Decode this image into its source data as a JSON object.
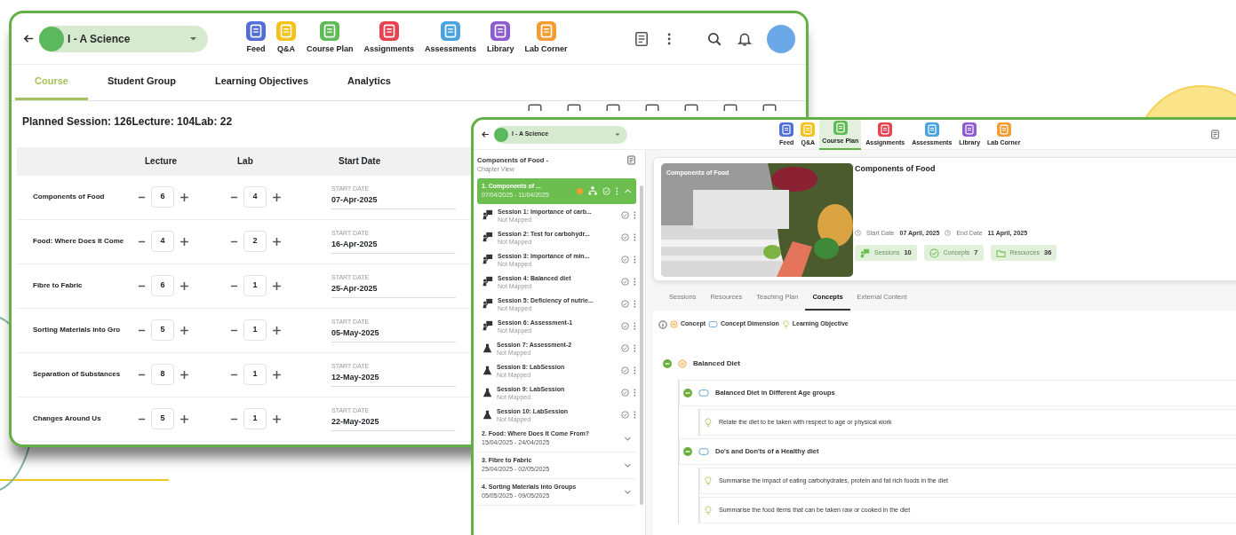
{
  "back_window": {
    "class_selector": {
      "label": "I - A Science"
    },
    "apps": [
      {
        "label": "Feed",
        "color": "#4f6fd6"
      },
      {
        "label": "Q&A",
        "color": "#f3c21b"
      },
      {
        "label": "Course Plan",
        "color": "#5fbb55"
      },
      {
        "label": "Assignments",
        "color": "#e6424f"
      },
      {
        "label": "Assessments",
        "color": "#4aa3df"
      },
      {
        "label": "Library",
        "color": "#8e5bd1"
      },
      {
        "label": "Lab Corner",
        "color": "#f39c33"
      }
    ],
    "tabs": [
      {
        "label": "Course",
        "selected": true
      },
      {
        "label": "Student Group",
        "selected": false
      },
      {
        "label": "Learning Objectives",
        "selected": false
      },
      {
        "label": "Analytics",
        "selected": false
      }
    ],
    "summary": "Planned Session: 126Lecture: 104Lab: 22",
    "table": {
      "columns": [
        "Lecture",
        "Lab",
        "Start Date"
      ],
      "rows": [
        {
          "chapter": "Components of Food",
          "lecture": "6",
          "lab": "4",
          "date_label": "START DATE",
          "start_date": "07-Apr-2025"
        },
        {
          "chapter": "Food: Where Does It Come",
          "lecture": "4",
          "lab": "2",
          "date_label": "START DATE",
          "start_date": "16-Apr-2025"
        },
        {
          "chapter": "Fibre to Fabric",
          "lecture": "6",
          "lab": "1",
          "date_label": "START DATE",
          "start_date": "25-Apr-2025"
        },
        {
          "chapter": "Sorting Materials into Gro",
          "lecture": "5",
          "lab": "1",
          "date_label": "START DATE",
          "start_date": "05-May-2025"
        },
        {
          "chapter": "Separation of Substances",
          "lecture": "8",
          "lab": "1",
          "date_label": "START DATE",
          "start_date": "12-May-2025"
        },
        {
          "chapter": "Changes Around Us",
          "lecture": "5",
          "lab": "1",
          "date_label": "START DATE",
          "start_date": "22-May-2025"
        }
      ]
    }
  },
  "front_window": {
    "class_selector": {
      "label": "I - A Science"
    },
    "apps": [
      {
        "label": "Feed",
        "color": "#4f6fd6",
        "selected": false
      },
      {
        "label": "Q&A",
        "color": "#f3c21b",
        "selected": false
      },
      {
        "label": "Course Plan",
        "color": "#5fbb55",
        "selected": true
      },
      {
        "label": "Assignments",
        "color": "#e6424f",
        "selected": false
      },
      {
        "label": "Assessments",
        "color": "#4aa3df",
        "selected": false
      },
      {
        "label": "Library",
        "color": "#8e5bd1",
        "selected": false
      },
      {
        "label": "Lab Corner",
        "color": "#f39c33",
        "selected": false
      }
    ],
    "sidebar": {
      "title": "Components of Food -",
      "subtitle": "Chapter View",
      "chapters": [
        {
          "title": "1. Components of ...",
          "dates": "07/04/2025 - 11/04/2025",
          "selected": true,
          "expanded": true,
          "sessions": [
            {
              "kind": "lecture",
              "title": "Session 1: Importance of carb...",
              "status": "Not Mapped"
            },
            {
              "kind": "lecture",
              "title": "Session 2: Test for carbohydr...",
              "status": "Not Mapped"
            },
            {
              "kind": "lecture",
              "title": "Session 3: Importance of min...",
              "status": "Not Mapped"
            },
            {
              "kind": "lecture",
              "title": "Session 4: Balanced diet",
              "status": "Not Mapped"
            },
            {
              "kind": "lecture",
              "title": "Session 5: Deficiency of nutrie...",
              "status": "Not Mapped"
            },
            {
              "kind": "lecture",
              "title": "Session 6: Assessment-1",
              "status": "Not Mapped"
            },
            {
              "kind": "lab",
              "title": "Session 7: Assessment-2",
              "status": "Not Mapped"
            },
            {
              "kind": "lab",
              "title": "Session 8: LabSession",
              "status": "Not Mapped"
            },
            {
              "kind": "lab",
              "title": "Session 9: LabSession",
              "status": "Not Mapped"
            },
            {
              "kind": "lab",
              "title": "Session 10: LabSession",
              "status": "Not Mapped"
            }
          ]
        },
        {
          "title": "2. Food: Where Does It Come From?",
          "dates": "15/04/2025 - 24/04/2025",
          "selected": false,
          "expanded": false
        },
        {
          "title": "3. Fibre to Fabric",
          "dates": "25/04/2025 - 02/05/2025",
          "selected": false,
          "expanded": false
        },
        {
          "title": "4. Sorting Materials into Groups",
          "dates": "05/05/2025 - 09/05/2025",
          "selected": false,
          "expanded": false
        }
      ]
    },
    "chapter": {
      "picture_label": "Components of Food",
      "title": "Components of Food",
      "dates": [
        {
          "label": "Start Date",
          "value": "07 April, 2025"
        },
        {
          "label": "End Date",
          "value": "11 April, 2025"
        }
      ],
      "stats": [
        {
          "kind": "sessions",
          "label": "Sessions",
          "value": "10"
        },
        {
          "kind": "concepts",
          "label": "Concepts",
          "value": "7"
        },
        {
          "kind": "resources",
          "label": "Resources",
          "value": "36"
        }
      ]
    },
    "tabs": [
      {
        "label": "Sessions",
        "selected": false
      },
      {
        "label": "Resources",
        "selected": false
      },
      {
        "label": "Teaching Plan",
        "selected": false
      },
      {
        "label": "Concepts",
        "selected": true
      },
      {
        "label": "External Content",
        "selected": false
      }
    ],
    "legend": [
      {
        "kind": "concept",
        "label": "Concept"
      },
      {
        "kind": "dimension",
        "label": "Concept Dimension"
      },
      {
        "kind": "objective",
        "label": "Learning Objective"
      }
    ],
    "concepts": [
      {
        "kind": "concept",
        "label": "Balanced Diet",
        "expanded": true,
        "children": [
          {
            "kind": "dimension",
            "label": "Balanced Diet in Different Age groups",
            "expanded": true,
            "children": [
              {
                "kind": "objective",
                "label": "Relate the diet to be taken with respect to age or physical work"
              }
            ]
          },
          {
            "kind": "dimension",
            "label": "Do's and Don'ts of a Healthy diet",
            "expanded": true,
            "children": [
              {
                "kind": "objective",
                "label": "Summarise the impact of eating carbohydrates, protein and fat rich foods in the diet"
              },
              {
                "kind": "objective",
                "label": "Summarise the food items that can be taken raw or cooked in the diet"
              }
            ]
          }
        ]
      }
    ]
  }
}
